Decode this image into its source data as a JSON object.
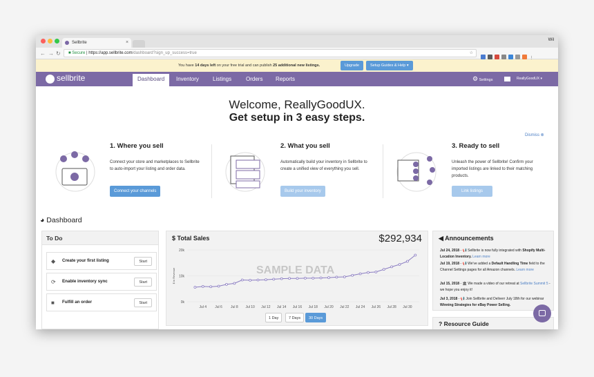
{
  "browser": {
    "tab_title": "Sellbrite",
    "tab_close": "×",
    "user": "Wil",
    "secure_label": "Secure",
    "url_host": "https://app.sellbrite.com",
    "url_path": "/dashboard?sign_up_success=true"
  },
  "banner": {
    "pre": "You have ",
    "days": "14 days left",
    "mid": " on your free trial and can publish ",
    "listings": "25 additional new listings.",
    "upgrade": "Upgrade",
    "guides": "Setup Guides & Help ▾"
  },
  "nav": {
    "logo": "sellbrite",
    "tabs": [
      "Dashboard",
      "Inventory",
      "Listings",
      "Orders",
      "Reports"
    ],
    "settings": "Settings",
    "user": "ReallyGoodUX ▾"
  },
  "welcome": {
    "line1": "Welcome, ReallyGoodUX.",
    "line2": "Get setup in 3 easy steps.",
    "dismiss": "Dismiss ⊗"
  },
  "steps": [
    {
      "title": "1. Where you sell",
      "desc": "Connect your store and marketplaces to Sellbrite to auto-import your listing and order data.",
      "button": "Connect your channels"
    },
    {
      "title": "2. What you sell",
      "desc": "Automatically build your inventory in Sellbrite to create a unified view of everything you sell.",
      "button": "Build your inventory"
    },
    {
      "title": "3. Ready to sell",
      "desc": "Unleash the power of Sellbrite! Confirm your imported listings are linked to their matching products.",
      "button": "Link listings"
    }
  ],
  "dashboard": {
    "title": "Dashboard",
    "todo": {
      "header": "To Do",
      "items": [
        {
          "label": "Create your first listing",
          "button": "Start",
          "icon": "tag-icon"
        },
        {
          "label": "Enable inventory sync",
          "button": "Start",
          "icon": "sync-icon"
        },
        {
          "label": "Fulfill an order",
          "button": "Start",
          "icon": "truck-icon"
        }
      ]
    },
    "sales": {
      "title": "Total Sales",
      "total": "$292,934",
      "watermark": "SAMPLE DATA",
      "ranges": [
        "1 Day",
        "7 Days",
        "30 Days"
      ],
      "selected_range": "30 Days"
    },
    "announcements": {
      "title": "Announcements",
      "items": [
        {
          "date": "Jul 24, 2018",
          "text": " - 📢 Sellbrite is now fully integrated with ",
          "bold": "Shopify Multi-Location Inventory.",
          "link": "Learn more"
        },
        {
          "date": "Jul 19, 2018",
          "text": " - 📢 We've added a ",
          "bold": "Default Handling Time",
          "text2": " field to the Channel Settings pages for all Amazon channels.",
          "link": "Learn more"
        },
        {
          "date": "Jul 15, 2018",
          "text": " - 🏛 We made a video of our retreat at ",
          "link": "Sellbrite Summit 5",
          "text2": " - we hope you enjoy it!"
        },
        {
          "date": "Jul 3, 2018",
          "text": " - 📢 Join Sellbrite and Deliverr July 18th for our webinar ",
          "bold": "Winning Strategies for eBay Power Selling."
        }
      ]
    },
    "resource_guide": "Resource Guide"
  },
  "chart_data": {
    "type": "line",
    "ylabel": "$ in Revenue",
    "y_ticks": [
      "20k",
      "10k",
      "0k"
    ],
    "ylim": [
      0,
      20000
    ],
    "x_ticks": [
      "Jul 4",
      "Jul 6",
      "Jul 8",
      "Jul 10",
      "Jul 12",
      "Jul 14",
      "Jul 16",
      "Jul 18",
      "Jul 20",
      "Jul 22",
      "Jul 24",
      "Jul 26",
      "Jul 28",
      "Jul 30"
    ],
    "x": [
      3,
      4,
      5,
      6,
      7,
      8,
      9,
      10,
      11,
      12,
      13,
      14,
      15,
      16,
      17,
      18,
      19,
      20,
      21,
      22,
      23,
      24,
      25,
      26,
      27,
      28,
      29,
      30,
      31
    ],
    "series": [
      {
        "values": [
          5600,
          5900,
          5800,
          6000,
          6700,
          7100,
          8400,
          8300,
          8400,
          8500,
          8700,
          8900,
          9000,
          9000,
          9100,
          9100,
          9200,
          9300,
          9500,
          9600,
          10200,
          10800,
          11300,
          11500,
          12500,
          13500,
          14400,
          15600,
          18000
        ]
      }
    ],
    "color": "#8a7cc1"
  }
}
